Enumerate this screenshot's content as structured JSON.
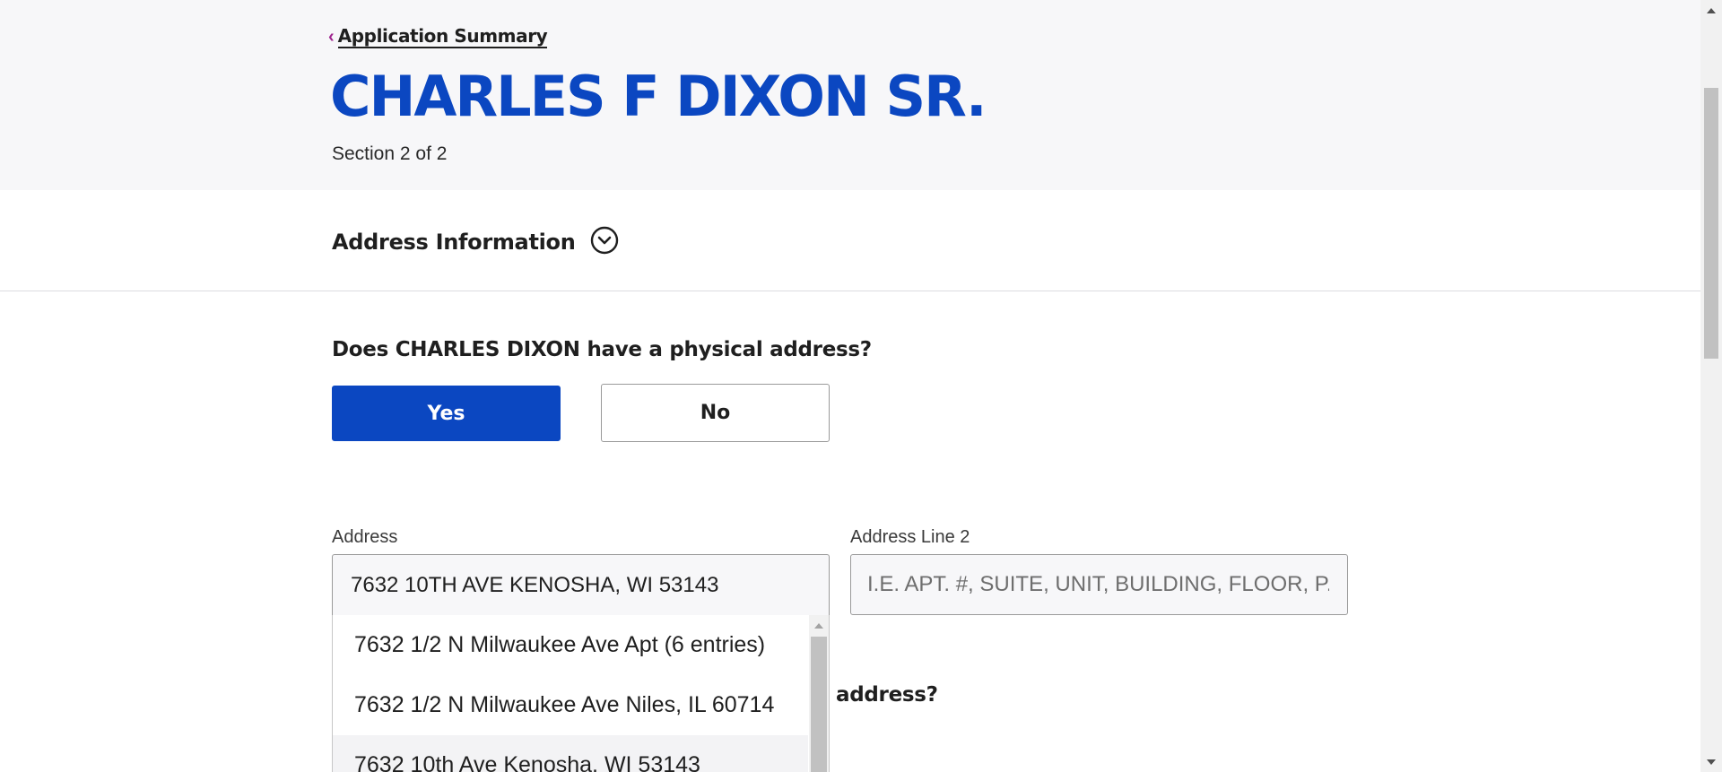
{
  "header": {
    "back_link_label": "Application Summary",
    "page_title": "CHARLES F DIXON SR.",
    "section_label": "Section 2 of 2"
  },
  "accordion": {
    "title": "Address Information",
    "toggle_icon": "chevron-down-circle-icon"
  },
  "question_physical": {
    "text": "Does CHARLES DIXON have a physical address?",
    "yes_label": "Yes",
    "no_label": "No",
    "selected": "Yes"
  },
  "address": {
    "label": "Address",
    "value": "7632 10TH AVE KENOSHA, WI 53143"
  },
  "address_line2": {
    "label": "Address Line 2",
    "placeholder": "I.E. APT. #, SUITE, UNIT, BUILDING, FLOOR, P.O. BOX"
  },
  "suggestions": [
    "7632 1/2 N Milwaukee Ave Apt (6 entries)",
    "7632 1/2 N Milwaukee Ave Niles, IL 60714",
    "7632 10th Ave Kenosha, WI 53143"
  ],
  "question_2_visible_text": "address?",
  "colors": {
    "brand_blue": "#0b47c1",
    "accent_magenta": "#a0268f",
    "header_bg": "#f7f7f9"
  }
}
